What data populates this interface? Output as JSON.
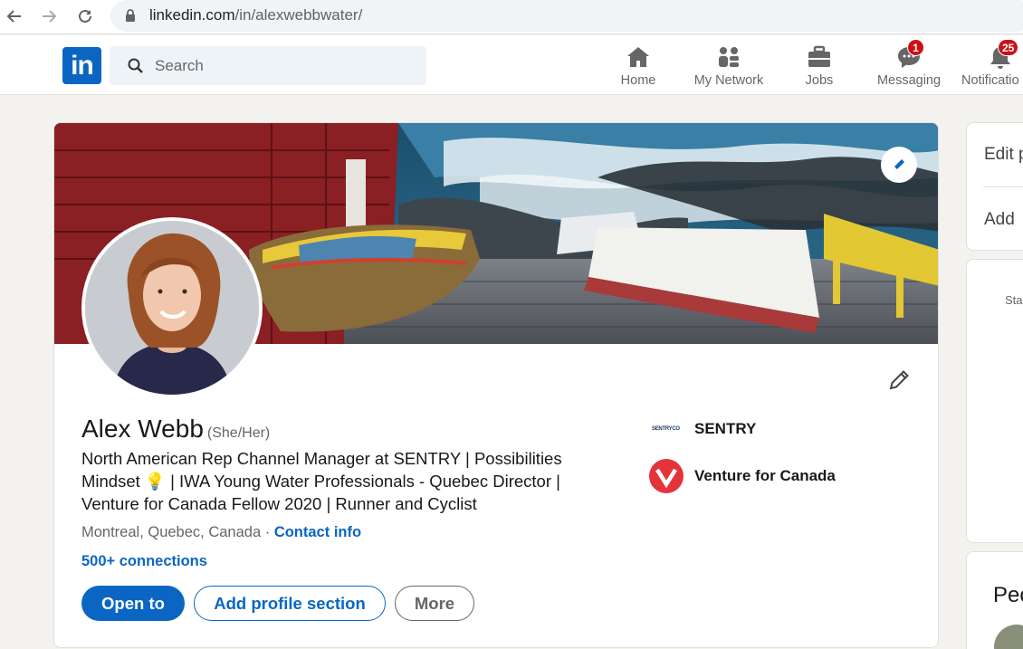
{
  "browser": {
    "url_domain": "linkedin.com",
    "url_path": "/in/alexwebbwater/"
  },
  "header": {
    "logo": "in",
    "search_placeholder": "Search",
    "nav": [
      {
        "label": "Home",
        "icon": "home-icon"
      },
      {
        "label": "My Network",
        "icon": "network-icon"
      },
      {
        "label": "Jobs",
        "icon": "briefcase-icon"
      },
      {
        "label": "Messaging",
        "icon": "messaging-icon",
        "badge": "1"
      },
      {
        "label": "Notificatio",
        "icon": "bell-icon",
        "badge": "25"
      }
    ]
  },
  "profile": {
    "name": "Alex Webb",
    "pronouns": "(She/Her)",
    "headline": "North American Rep Channel Manager at SENTRY | Possibilities Mindset 💡 | IWA Young Water Professionals - Quebec Director | Venture for Canada Fellow 2020 | Runner and Cyclist",
    "location": "Montreal, Quebec, Canada",
    "separator": "·",
    "contact_info": "Contact info",
    "connections": "500+ connections",
    "buttons": {
      "open_to": "Open to",
      "add_section": "Add profile section",
      "more": "More"
    },
    "orgs": [
      {
        "name": "SENTRY",
        "logo_text": "SENTRYCO"
      },
      {
        "name": "Venture for Canada"
      }
    ]
  },
  "rail": {
    "edit": "Edit p",
    "add": "Add",
    "sta": "Sta",
    "people": "Peo"
  },
  "colors": {
    "brand": "#0a66c2",
    "badge": "#cc1016",
    "venture": "#e3343a"
  }
}
